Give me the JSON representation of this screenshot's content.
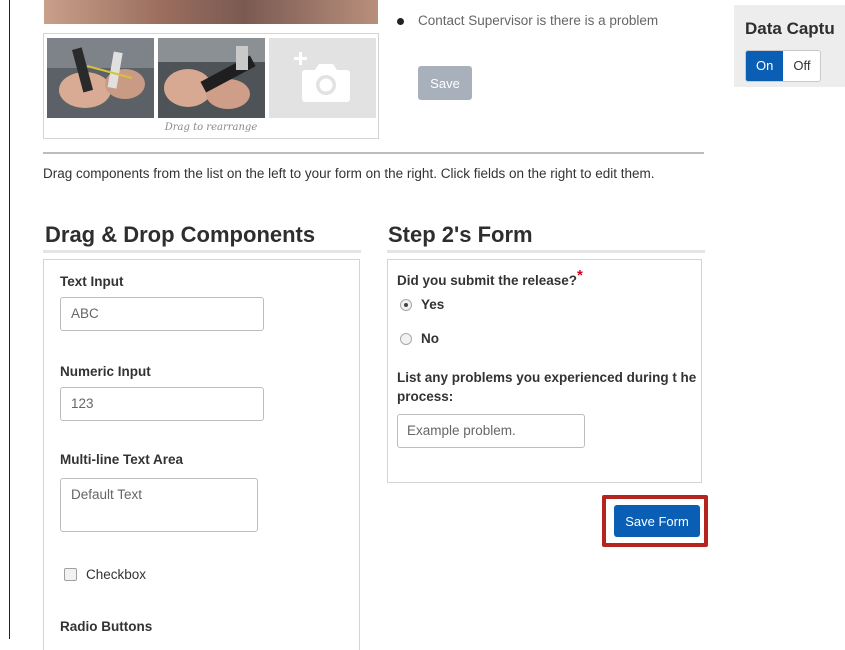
{
  "gallery": {
    "caption": "Drag to rearrange"
  },
  "notes": {
    "bullet": "Contact Supervisor is there is a problem",
    "save_label": "Save"
  },
  "capture": {
    "title": "Data Captu",
    "on_label": "On",
    "off_label": "Off",
    "selected": "On",
    "accent_color": "#0a5eb4"
  },
  "instructions": "Drag components from the list on the left to your form on the right. Click fields on the right to edit them.",
  "components": {
    "title": "Drag & Drop Components",
    "text_input": {
      "label": "Text Input",
      "value": "ABC"
    },
    "numeric_input": {
      "label": "Numeric Input",
      "value": "123"
    },
    "text_area": {
      "label": "Multi-line Text Area",
      "value": "Default Text"
    },
    "checkbox": {
      "label": "Checkbox"
    },
    "radio": {
      "label": "Radio Buttons"
    }
  },
  "form": {
    "title": "Step 2's Form",
    "q1": {
      "label": "Did you submit the release?",
      "required_mark": "*",
      "options": [
        "Yes",
        "No"
      ],
      "selected": "Yes"
    },
    "q2": {
      "label": "List any problems you experienced during t he process:",
      "placeholder": "Example problem."
    },
    "save_label": "Save Form",
    "highlight_color": "#b5241f"
  }
}
